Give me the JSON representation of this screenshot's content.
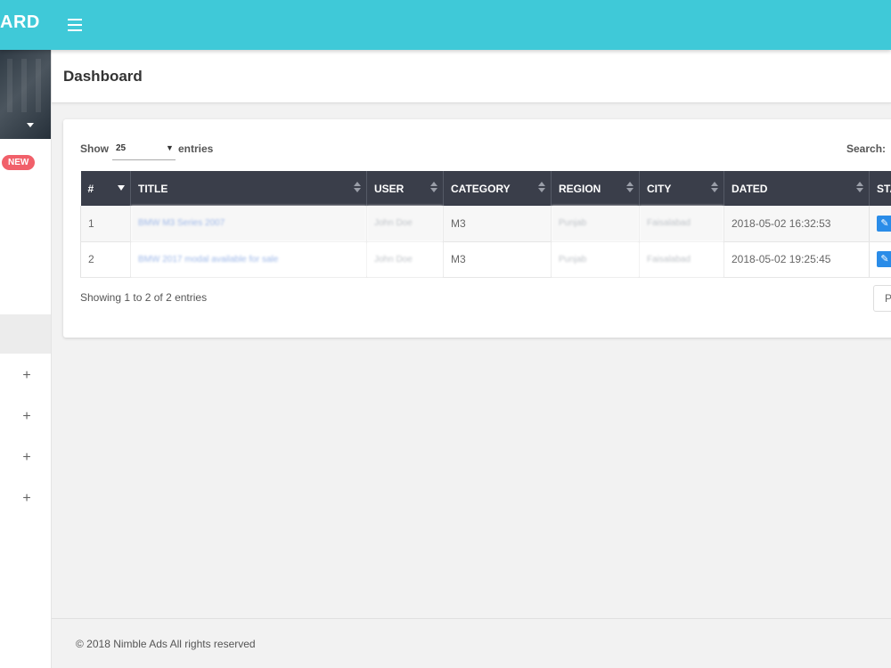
{
  "header": {
    "brand": "ARD"
  },
  "sidebar": {
    "badge": "NEW",
    "expanders": [
      "+",
      "+",
      "+",
      "+"
    ]
  },
  "page": {
    "title": "Dashboard"
  },
  "table_controls": {
    "show_label": "Show",
    "length_value": "25",
    "entries_label": "entries",
    "search_label": "Search:"
  },
  "table": {
    "columns": [
      "#",
      "TITLE",
      "USER",
      "CATEGORY",
      "REGION",
      "CITY",
      "DATED",
      "STA"
    ],
    "rows": [
      {
        "num": "1",
        "title": "BMW M3 Series 2007",
        "user": "John Doe",
        "category": "M3",
        "region": "Punjab",
        "city": "Faisalabad",
        "dated": "2018-05-02 16:32:53"
      },
      {
        "num": "2",
        "title": "BMW 2017 modal available for sale",
        "user": "John Doe",
        "category": "M3",
        "region": "Punjab",
        "city": "Faisalabad",
        "dated": "2018-05-02 19:25:45"
      }
    ]
  },
  "info": "Showing 1 to 2 of 2 entries",
  "pagination": {
    "label": "P"
  },
  "footer": {
    "text": "© 2018 Nimble Ads All rights reserved"
  },
  "colors": {
    "topbar": "#3fc9d8",
    "table_header": "#3a3e4a",
    "badge": "#f1606a",
    "action_button": "#2a8ce8"
  },
  "icons": {
    "menu": "hamburger-icon",
    "user_caret": "caret-down-icon",
    "sort": "sort-icon",
    "edit": "edit-icon",
    "expand": "plus-icon"
  }
}
